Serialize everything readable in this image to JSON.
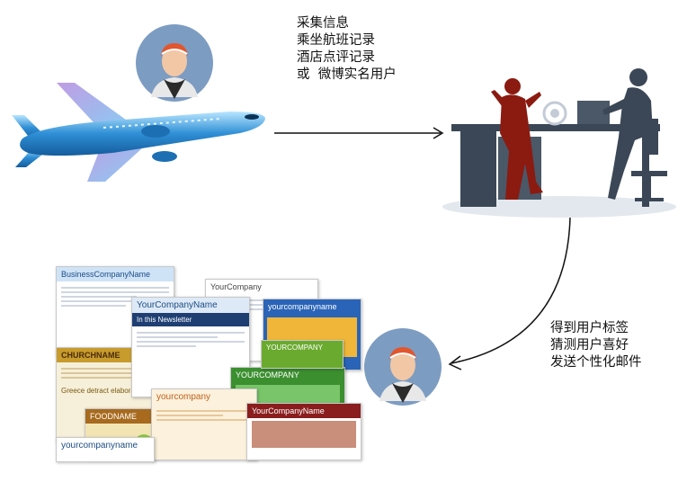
{
  "top_text": {
    "lines": [
      "采集信息",
      "乘坐航班记录",
      "酒店点评记录",
      "或  微博实名用户"
    ]
  },
  "bottom_text": {
    "lines": [
      "得到用户标签",
      "猜测用户喜好",
      "发送个性化邮件"
    ]
  },
  "newsletters": {
    "business_company_name": "BusinessCompanyName",
    "your_company_top": "YourCompany",
    "your_company_name_left": "YourCompanyName",
    "in_this_newsletter": "In this Newsletter",
    "your_company_lower_blue": "yourcompanyname",
    "your_company_green": "YOURCOMPANY",
    "your_company_lower_orange": "yourcompany",
    "your_company_red": "YourCompanyName",
    "your_company_bottom": "yourcompanyname",
    "church_name": "CHURCHNAME",
    "food_name": "FOODNAME",
    "your_company_small_green": "YOURCOMPANY",
    "greece_retreat": "Greece detract elaborant"
  },
  "colors": {
    "airplane_blue": "#2f8fd6",
    "desk_dark": "#3b4756",
    "person_red": "#8b1a10",
    "avatar_bg": "#7d9cc2",
    "arrow": "#111111"
  }
}
